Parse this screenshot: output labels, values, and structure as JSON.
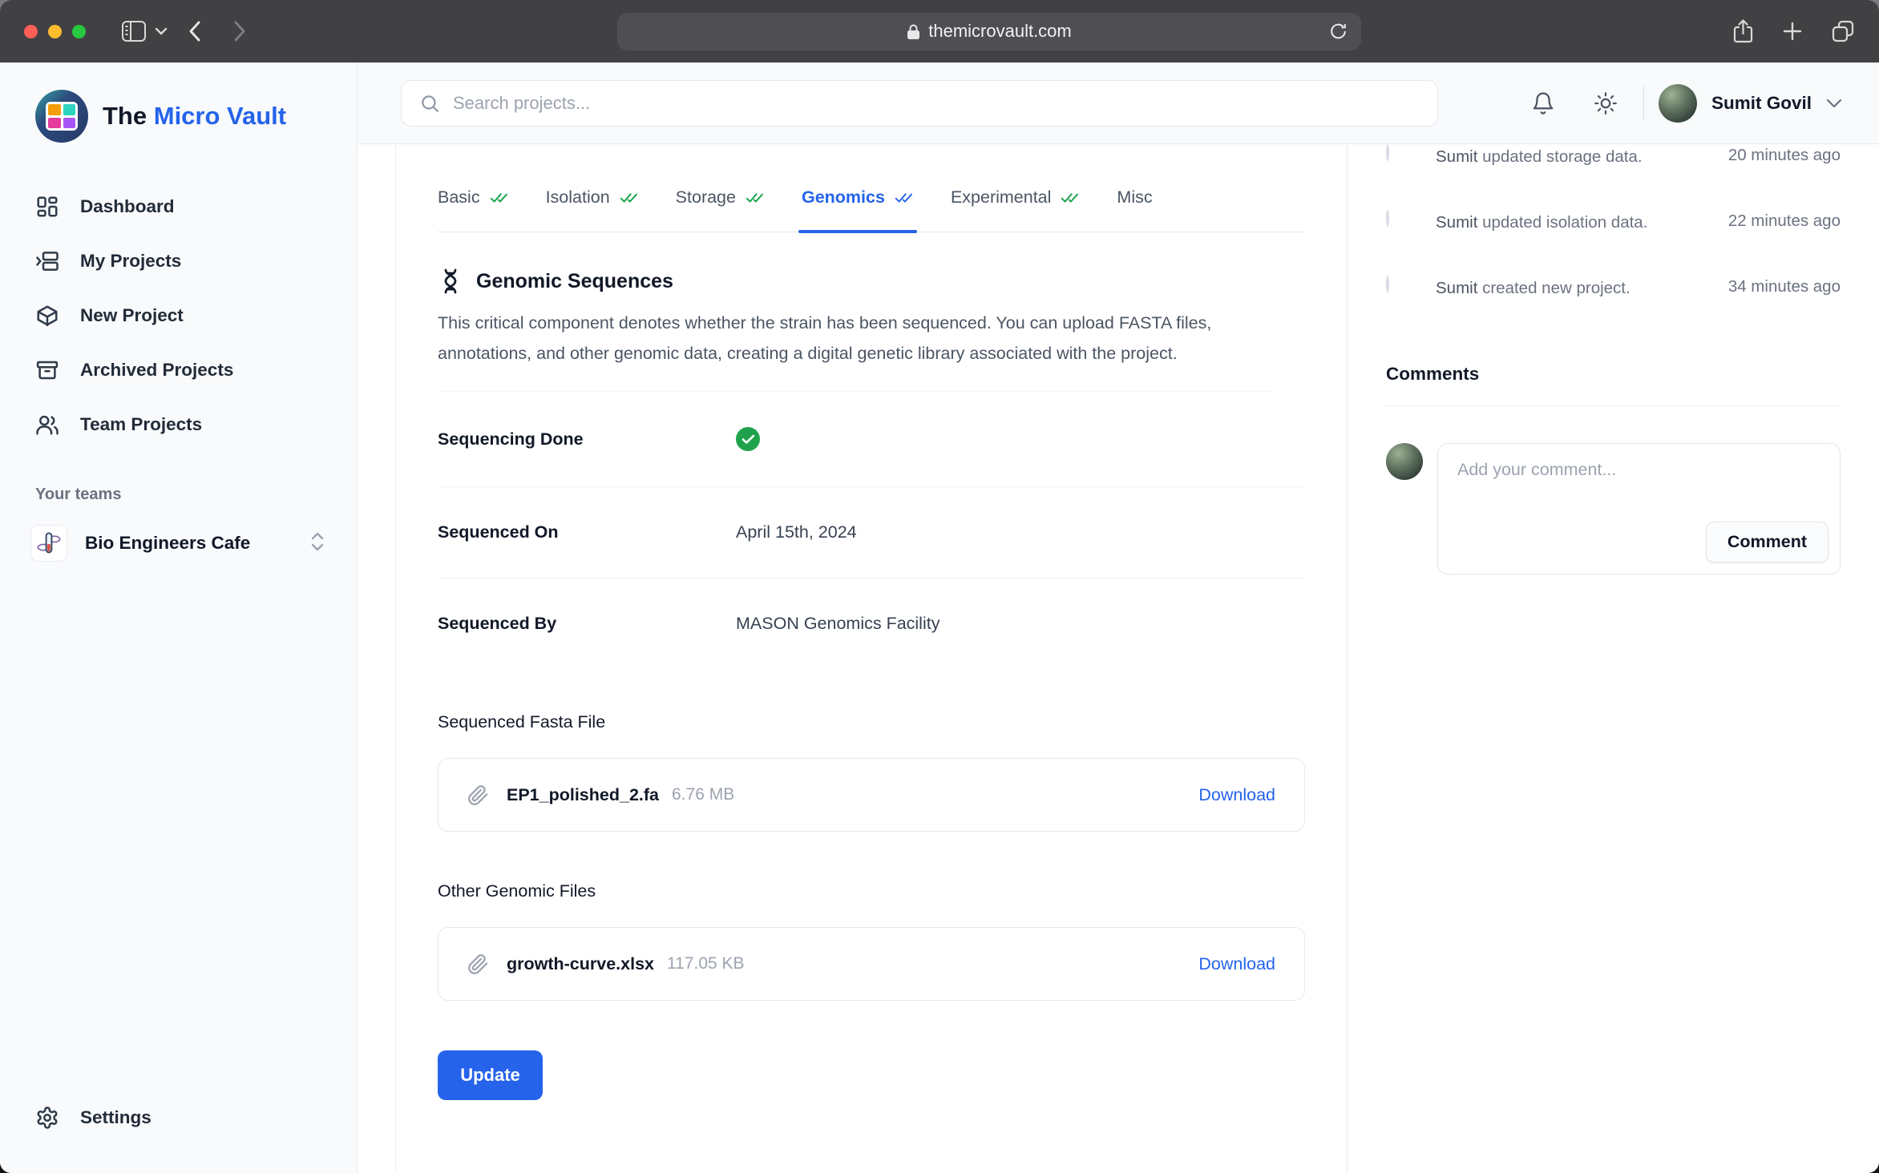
{
  "browser": {
    "url": "themicrovault.com"
  },
  "app": {
    "title_prefix": "The",
    "title_accent": "Micro Vault"
  },
  "sidebar": {
    "items": [
      {
        "label": "Dashboard"
      },
      {
        "label": "My Projects"
      },
      {
        "label": "New Project"
      },
      {
        "label": "Archived Projects"
      },
      {
        "label": "Team Projects"
      }
    ],
    "teams_label": "Your teams",
    "team": {
      "name": "Bio Engineers Cafe"
    },
    "settings_label": "Settings"
  },
  "header": {
    "search_placeholder": "Search projects...",
    "user_name": "Sumit Govil"
  },
  "tabs": [
    {
      "label": "Basic",
      "checked": true
    },
    {
      "label": "Isolation",
      "checked": true
    },
    {
      "label": "Storage",
      "checked": true
    },
    {
      "label": "Genomics",
      "checked": true,
      "active": true
    },
    {
      "label": "Experimental",
      "checked": true
    },
    {
      "label": "Misc",
      "checked": false
    }
  ],
  "genomics": {
    "section_title": "Genomic Sequences",
    "description": "This critical component denotes whether the strain has been sequenced. You can upload FASTA files, annotations, and other genomic data, creating a digital genetic library associated with the project.",
    "fields": [
      {
        "label": "Sequencing Done",
        "value": "checked"
      },
      {
        "label": "Sequenced On",
        "value": "April 15th, 2024"
      },
      {
        "label": "Sequenced By",
        "value": "MASON Genomics Facility"
      }
    ],
    "fasta_heading": "Sequenced Fasta File",
    "fasta_file": {
      "name": "EP1_polished_2.fa",
      "size": "6.76 MB",
      "action": "Download"
    },
    "other_heading": "Other Genomic Files",
    "other_file": {
      "name": "growth-curve.xlsx",
      "size": "117.05 KB",
      "action": "Download"
    },
    "update_label": "Update"
  },
  "activity": {
    "items": [
      {
        "actor": "Sumit",
        "text": " updated storage data.",
        "time": "20 minutes ago"
      },
      {
        "actor": "Sumit",
        "text": " updated isolation data.",
        "time": "22 minutes ago"
      },
      {
        "actor": "Sumit",
        "text": " created new project.",
        "time": "34 minutes ago"
      }
    ]
  },
  "comments": {
    "heading": "Comments",
    "placeholder": "Add your comment...",
    "button_label": "Comment"
  },
  "colors": {
    "accent": "#2563eb",
    "success": "#16a34a"
  }
}
